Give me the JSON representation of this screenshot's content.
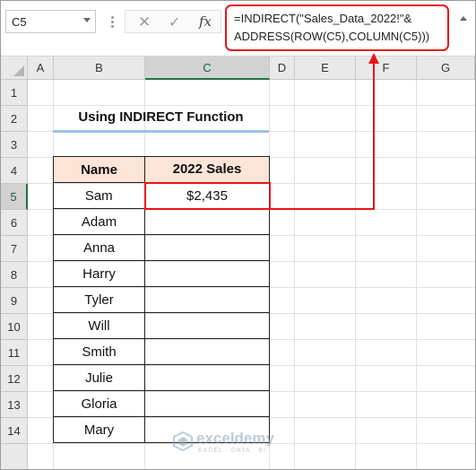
{
  "name_box": {
    "value": "C5"
  },
  "formula_bar": {
    "cancel_icon": "✕",
    "enter_icon": "✓",
    "fx_label": "fx",
    "formula_line1": "=INDIRECT(\"Sales_Data_2022!\"&",
    "formula_line2": "ADDRESS(ROW(C5),COLUMN(C5)))"
  },
  "columns": [
    "A",
    "B",
    "C",
    "D",
    "E",
    "F",
    "G"
  ],
  "rows": [
    "1",
    "2",
    "3",
    "4",
    "5",
    "6",
    "7",
    "8",
    "9",
    "10",
    "11",
    "12",
    "13",
    "14"
  ],
  "selected_column": "C",
  "selected_row": "5",
  "sheet": {
    "title": "Using INDIRECT Function",
    "table": {
      "headers": [
        "Name",
        "2022 Sales"
      ],
      "rows": [
        [
          "Sam",
          "$2,435"
        ],
        [
          "Adam",
          ""
        ],
        [
          "Anna",
          ""
        ],
        [
          "Harry",
          ""
        ],
        [
          "Tyler",
          ""
        ],
        [
          "Will",
          ""
        ],
        [
          "Smith",
          ""
        ],
        [
          "Julie",
          ""
        ],
        [
          "Gloria",
          ""
        ],
        [
          "Mary",
          ""
        ]
      ]
    }
  },
  "watermark": {
    "name": "exceldemy",
    "tagline": "EXCEL · DATA · BI"
  },
  "colors": {
    "highlight": "#e8141c",
    "header_fill": "#fce4d6",
    "title_underline": "#9dc3e6",
    "selection": "#217346"
  }
}
